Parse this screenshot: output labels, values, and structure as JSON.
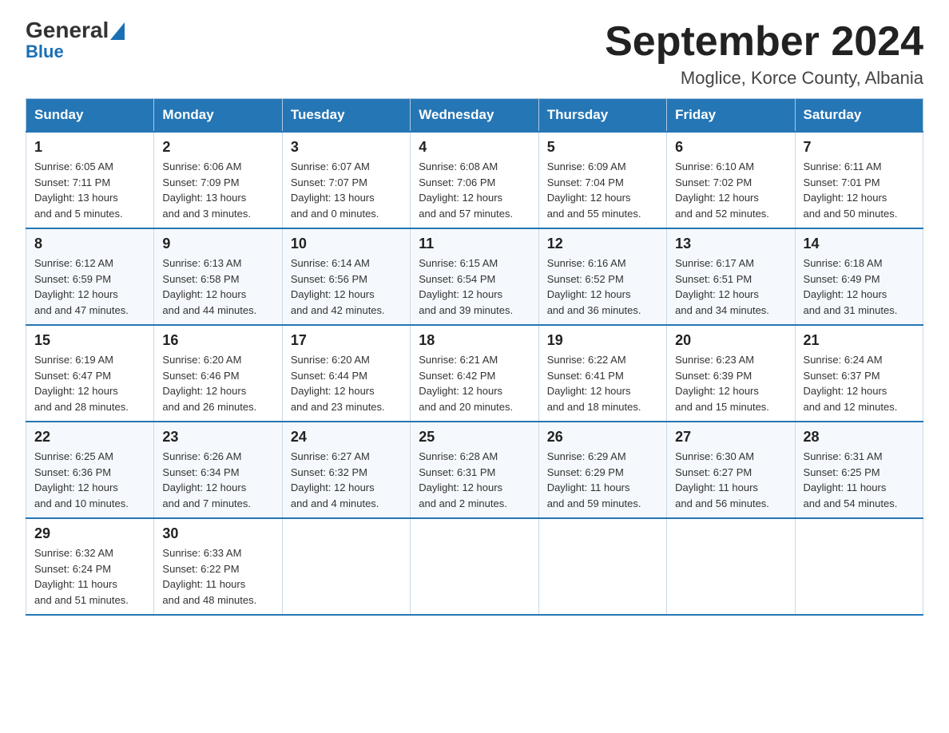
{
  "header": {
    "logo_general": "General",
    "logo_blue": "Blue",
    "month_title": "September 2024",
    "location": "Moglice, Korce County, Albania"
  },
  "days_of_week": [
    "Sunday",
    "Monday",
    "Tuesday",
    "Wednesday",
    "Thursday",
    "Friday",
    "Saturday"
  ],
  "weeks": [
    [
      {
        "day": "1",
        "sunrise": "6:05 AM",
        "sunset": "7:11 PM",
        "daylight": "13 hours and 5 minutes."
      },
      {
        "day": "2",
        "sunrise": "6:06 AM",
        "sunset": "7:09 PM",
        "daylight": "13 hours and 3 minutes."
      },
      {
        "day": "3",
        "sunrise": "6:07 AM",
        "sunset": "7:07 PM",
        "daylight": "13 hours and 0 minutes."
      },
      {
        "day": "4",
        "sunrise": "6:08 AM",
        "sunset": "7:06 PM",
        "daylight": "12 hours and 57 minutes."
      },
      {
        "day": "5",
        "sunrise": "6:09 AM",
        "sunset": "7:04 PM",
        "daylight": "12 hours and 55 minutes."
      },
      {
        "day": "6",
        "sunrise": "6:10 AM",
        "sunset": "7:02 PM",
        "daylight": "12 hours and 52 minutes."
      },
      {
        "day": "7",
        "sunrise": "6:11 AM",
        "sunset": "7:01 PM",
        "daylight": "12 hours and 50 minutes."
      }
    ],
    [
      {
        "day": "8",
        "sunrise": "6:12 AM",
        "sunset": "6:59 PM",
        "daylight": "12 hours and 47 minutes."
      },
      {
        "day": "9",
        "sunrise": "6:13 AM",
        "sunset": "6:58 PM",
        "daylight": "12 hours and 44 minutes."
      },
      {
        "day": "10",
        "sunrise": "6:14 AM",
        "sunset": "6:56 PM",
        "daylight": "12 hours and 42 minutes."
      },
      {
        "day": "11",
        "sunrise": "6:15 AM",
        "sunset": "6:54 PM",
        "daylight": "12 hours and 39 minutes."
      },
      {
        "day": "12",
        "sunrise": "6:16 AM",
        "sunset": "6:52 PM",
        "daylight": "12 hours and 36 minutes."
      },
      {
        "day": "13",
        "sunrise": "6:17 AM",
        "sunset": "6:51 PM",
        "daylight": "12 hours and 34 minutes."
      },
      {
        "day": "14",
        "sunrise": "6:18 AM",
        "sunset": "6:49 PM",
        "daylight": "12 hours and 31 minutes."
      }
    ],
    [
      {
        "day": "15",
        "sunrise": "6:19 AM",
        "sunset": "6:47 PM",
        "daylight": "12 hours and 28 minutes."
      },
      {
        "day": "16",
        "sunrise": "6:20 AM",
        "sunset": "6:46 PM",
        "daylight": "12 hours and 26 minutes."
      },
      {
        "day": "17",
        "sunrise": "6:20 AM",
        "sunset": "6:44 PM",
        "daylight": "12 hours and 23 minutes."
      },
      {
        "day": "18",
        "sunrise": "6:21 AM",
        "sunset": "6:42 PM",
        "daylight": "12 hours and 20 minutes."
      },
      {
        "day": "19",
        "sunrise": "6:22 AM",
        "sunset": "6:41 PM",
        "daylight": "12 hours and 18 minutes."
      },
      {
        "day": "20",
        "sunrise": "6:23 AM",
        "sunset": "6:39 PM",
        "daylight": "12 hours and 15 minutes."
      },
      {
        "day": "21",
        "sunrise": "6:24 AM",
        "sunset": "6:37 PM",
        "daylight": "12 hours and 12 minutes."
      }
    ],
    [
      {
        "day": "22",
        "sunrise": "6:25 AM",
        "sunset": "6:36 PM",
        "daylight": "12 hours and 10 minutes."
      },
      {
        "day": "23",
        "sunrise": "6:26 AM",
        "sunset": "6:34 PM",
        "daylight": "12 hours and 7 minutes."
      },
      {
        "day": "24",
        "sunrise": "6:27 AM",
        "sunset": "6:32 PM",
        "daylight": "12 hours and 4 minutes."
      },
      {
        "day": "25",
        "sunrise": "6:28 AM",
        "sunset": "6:31 PM",
        "daylight": "12 hours and 2 minutes."
      },
      {
        "day": "26",
        "sunrise": "6:29 AM",
        "sunset": "6:29 PM",
        "daylight": "11 hours and 59 minutes."
      },
      {
        "day": "27",
        "sunrise": "6:30 AM",
        "sunset": "6:27 PM",
        "daylight": "11 hours and 56 minutes."
      },
      {
        "day": "28",
        "sunrise": "6:31 AM",
        "sunset": "6:25 PM",
        "daylight": "11 hours and 54 minutes."
      }
    ],
    [
      {
        "day": "29",
        "sunrise": "6:32 AM",
        "sunset": "6:24 PM",
        "daylight": "11 hours and 51 minutes."
      },
      {
        "day": "30",
        "sunrise": "6:33 AM",
        "sunset": "6:22 PM",
        "daylight": "11 hours and 48 minutes."
      },
      null,
      null,
      null,
      null,
      null
    ]
  ],
  "labels": {
    "sunrise": "Sunrise:",
    "sunset": "Sunset:",
    "daylight": "Daylight:"
  }
}
